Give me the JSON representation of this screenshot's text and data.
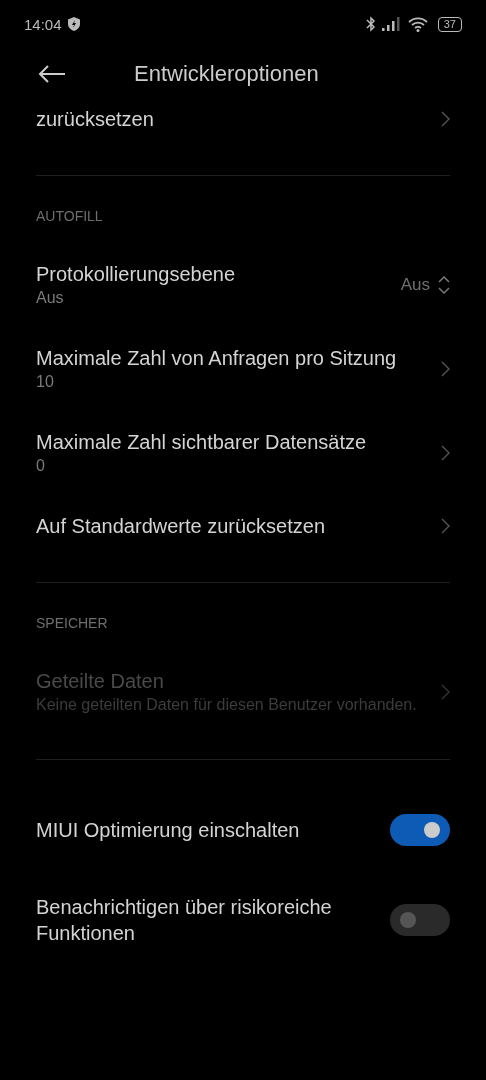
{
  "status_bar": {
    "time": "14:04",
    "battery": "37"
  },
  "header": {
    "title": "Entwickleroptionen"
  },
  "sections": [
    {
      "items": [
        {
          "kind": "nav",
          "title": "zurücksetzen",
          "disabled": false
        }
      ]
    },
    {
      "heading": "AUTOFILL",
      "items": [
        {
          "kind": "select",
          "title": "Protokollierungsebene",
          "subtitle": "Aus",
          "value": "Aus",
          "disabled": false
        },
        {
          "kind": "nav",
          "title": "Maximale Zahl von Anfragen pro Sitzung",
          "subtitle": "10",
          "disabled": false
        },
        {
          "kind": "nav",
          "title": "Maximale Zahl sichtbarer Datensätze",
          "subtitle": "0",
          "disabled": false
        },
        {
          "kind": "nav",
          "title": "Auf Standardwerte zurücksetzen",
          "disabled": false
        }
      ]
    },
    {
      "heading": "SPEICHER",
      "items": [
        {
          "kind": "nav",
          "title": "Geteilte Daten",
          "subtitle": "Keine geteilten Daten für diesen Benutzer vorhanden.",
          "disabled": true
        }
      ]
    },
    {
      "items": [
        {
          "kind": "toggle",
          "title": "MIUI Optimierung einschalten",
          "on": true,
          "disabled": false
        },
        {
          "kind": "toggle",
          "title": "Benachrichtigen über risikoreiche Funktionen",
          "on": false,
          "disabled": false
        }
      ]
    }
  ]
}
